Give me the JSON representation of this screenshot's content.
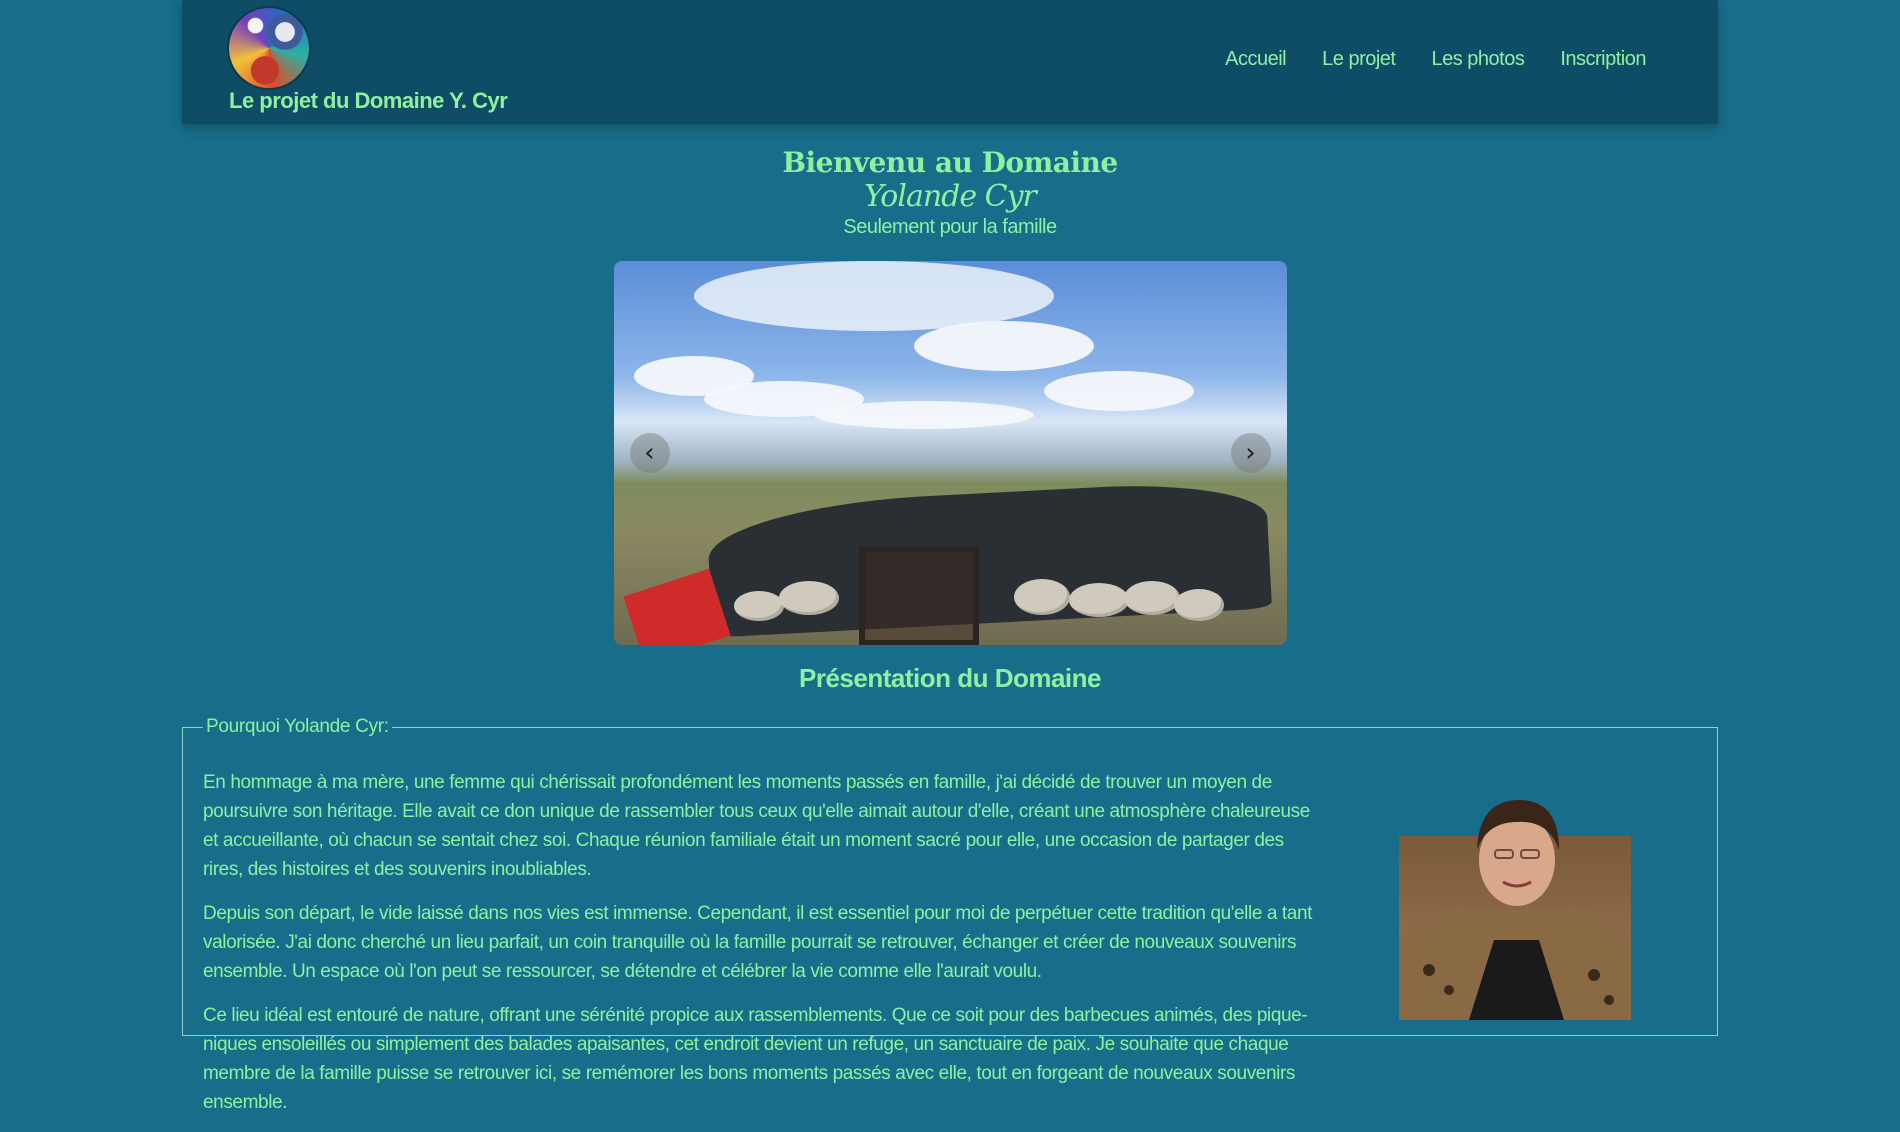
{
  "header": {
    "site_title": "Le projet du Domaine Y. Cyr",
    "nav": [
      {
        "label": "Accueil"
      },
      {
        "label": "Le projet"
      },
      {
        "label": "Les photos"
      },
      {
        "label": "Inscription"
      }
    ]
  },
  "hero": {
    "title": "Bienvenu au Domaine",
    "name_script": "Yolande Cyr",
    "tagline": "Seulement pour la famille"
  },
  "carousel": {
    "prev_icon": "‹",
    "next_icon": "›"
  },
  "presentation": {
    "title": "Présentation du Domaine",
    "legend": "Pourquoi Yolande Cyr:",
    "paragraphs": [
      "En hommage à ma mère, une femme qui chérissait profondément les moments passés en famille, j'ai décidé de trouver un moyen de poursuivre son héritage. Elle avait ce don unique de rassembler tous ceux qu'elle aimait autour d'elle, créant une atmosphère chaleureuse et accueillante, où chacun se sentait chez soi. Chaque réunion familiale était un moment sacré pour elle, une occasion de partager des rires, des histoires et des souvenirs inoubliables.",
      "Depuis son départ, le vide laissé dans nos vies est immense. Cependant, il est essentiel pour moi de perpétuer cette tradition qu'elle a tant valorisée. J'ai donc cherché un lieu parfait, un coin tranquille où la famille pourrait se retrouver, échanger et créer de nouveaux souvenirs ensemble. Un espace où l'on peut se ressourcer, se détendre et célébrer la vie comme elle l'aurait voulu.",
      "Ce lieu idéal est entouré de nature, offrant une sérénité propice aux rassemblements. Que ce soit pour des barbecues animés, des pique-niques ensoleillés ou simplement des balades apaisantes, cet endroit devient un refuge, un sanctuaire de paix. Je souhaite que chaque membre de la famille puisse se retrouver ici, se remémorer les bons moments passés avec elle, tout en forgeant de nouveaux souvenirs ensemble."
    ]
  }
}
